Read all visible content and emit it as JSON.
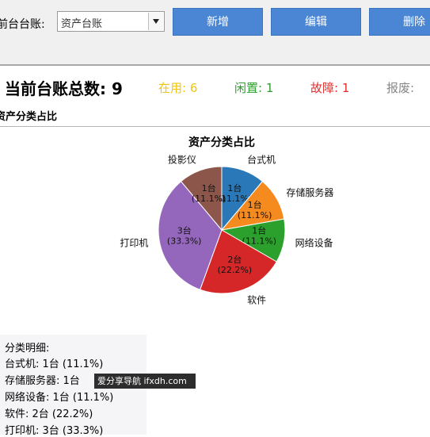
{
  "toolbar": {
    "ledger_label": "前台台账:",
    "ledger_select": "资产台账",
    "buttons": [
      "新增",
      "编辑",
      "删除"
    ]
  },
  "summary": {
    "total": "当前台账总数: 9",
    "in_use": "在用: 6",
    "idle": "闲置: 1",
    "fault": "故障: 1",
    "scrap": "报废:",
    "colors": {
      "in_use": "#f1c40f",
      "idle": "#2e9e2e",
      "fault": "#e03030",
      "scrap": "#888888"
    }
  },
  "section_title": "资产分类占比",
  "chart_data": {
    "type": "pie",
    "title": "资产分类占比",
    "slices": [
      {
        "category": "台式机",
        "value": 1,
        "label": "1台\n(11.1%)",
        "color": "#2a78b8"
      },
      {
        "category": "存储服务器",
        "value": 1,
        "label": "1台\n(11.1%)",
        "color": "#f58a1e"
      },
      {
        "category": "网络设备",
        "value": 1,
        "label": "1台\n(11.1%)",
        "color": "#2ca02c"
      },
      {
        "category": "软件",
        "value": 2,
        "label": "2台\n(22.2%)",
        "color": "#d62728"
      },
      {
        "category": "打印机",
        "value": 3,
        "label": "3台\n(33.3%)",
        "color": "#9467bd"
      },
      {
        "category": "投影仪",
        "value": 1,
        "label": "1台\n(11.1%)",
        "color": "#8c564b"
      }
    ]
  },
  "detail": {
    "heading": "分类明细:",
    "lines": [
      "台式机: 1台 (11.1%)",
      "存储服务器: 1台",
      "网络设备: 1台 (11.1%)",
      "软件: 2台 (22.2%)",
      "打印机: 3台 (33.3%)"
    ]
  },
  "watermark": "爱分享导航 ifxdh.com"
}
